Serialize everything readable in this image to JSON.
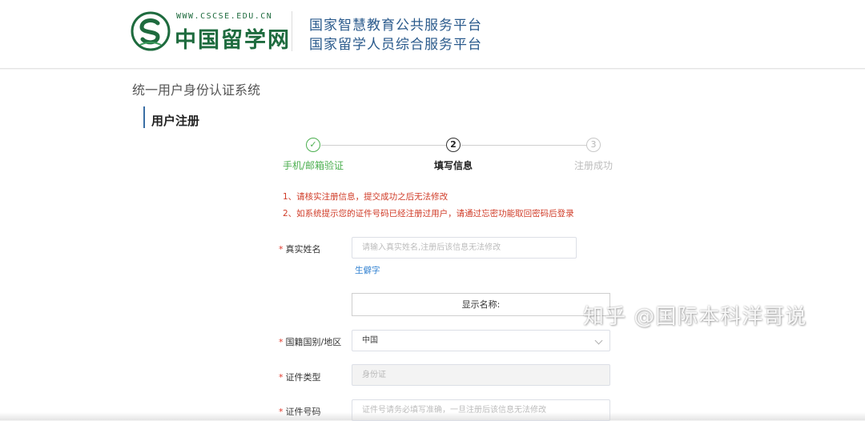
{
  "header": {
    "logo_url": "WWW.CSCSE.EDU.CN",
    "logo_name": "中国留学网",
    "platform_line1": "国家智慧教育公共服务平台",
    "platform_line2": "国家留学人员综合服务平台",
    "brand_color": "#1e6b3e"
  },
  "page": {
    "system_title": "统一用户身份认证系统",
    "section_title": "用户注册"
  },
  "steps": [
    {
      "number": "✓",
      "label": "手机/邮箱验证",
      "state": "done"
    },
    {
      "number": "2",
      "label": "填写信息",
      "state": "active"
    },
    {
      "number": "3",
      "label": "注册成功",
      "state": "pending"
    }
  ],
  "notices": [
    "1、请核实注册信息，提交成功之后无法修改",
    "2、如系统提示您的证件号码已经注册过用户，请通过忘密功能取回密码后登录"
  ],
  "form": {
    "required_mark": "*",
    "real_name": {
      "label": "真实姓名",
      "placeholder": "请输入真实姓名,注册后该信息无法修改"
    },
    "rare_char_link": "生僻字",
    "display_name_label": "显示名称:",
    "nationality": {
      "label": "国籍国别/地区",
      "value": "中国"
    },
    "id_type": {
      "label": "证件类型",
      "value": "身份证"
    },
    "id_number": {
      "label": "证件号码",
      "placeholder": "证件号请务必填写准确，一旦注册后该信息无法修改"
    }
  },
  "watermark": "知乎 @国际本科洋哥说",
  "colors": {
    "step_done": "#4caf50",
    "notice": "#d03c28",
    "link": "#2e7fd0",
    "required": "#e0392b"
  }
}
